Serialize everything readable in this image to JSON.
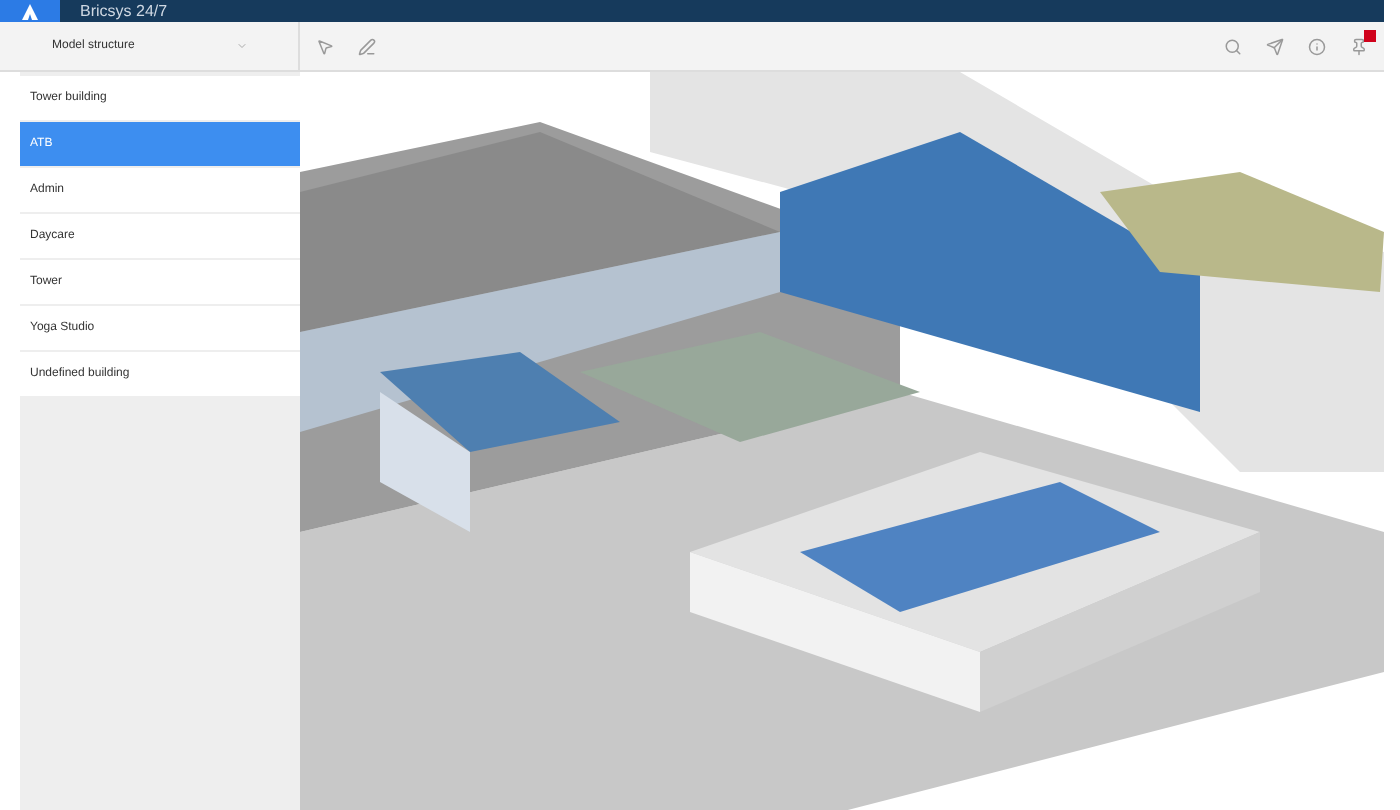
{
  "window": {
    "title": "Bricsys 24/7"
  },
  "panel": {
    "dropdown": "Model structure"
  },
  "tree": [
    {
      "label": "Tower building",
      "selected": false
    },
    {
      "label": "ATB",
      "selected": true
    },
    {
      "label": "Admin",
      "selected": false
    },
    {
      "label": "Daycare",
      "selected": false
    },
    {
      "label": "Tower",
      "selected": false
    },
    {
      "label": "Yoga Studio",
      "selected": false
    },
    {
      "label": "Undefined building",
      "selected": false
    }
  ],
  "notifications": {
    "unread": true
  }
}
